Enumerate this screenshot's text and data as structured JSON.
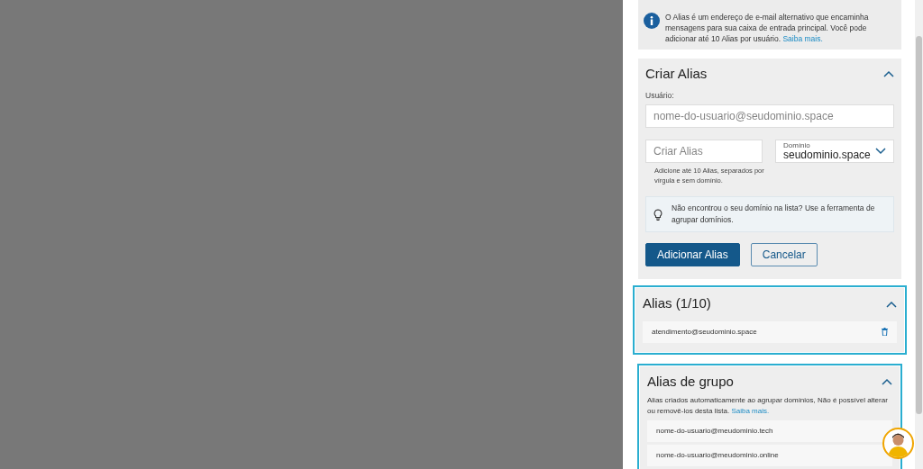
{
  "info": {
    "text": "O Alias é um endereço de e-mail alternativo que encaminha mensagens para sua caixa de entrada principal. Você pode adicionar até 10 Alias por usuário.",
    "link": "Saiba mais."
  },
  "create": {
    "title": "Criar Alias",
    "expanded": true,
    "user_label": "Usuário:",
    "user_placeholder": "nome-do-usuario@seudominio.space",
    "alias_placeholder": "Criar Alias",
    "hint": "Adicione até 10 Alias, separados por vírgula e sem domínio.",
    "domain_label": "Domínio",
    "domain_value": "seudominio.space",
    "tip": "Não encontrou o seu domínio na lista? Use a ferramenta de agrupar domínios.",
    "buttons": [
      {
        "label": "Adicionar Alias",
        "kind": "primary"
      },
      {
        "label": "Cancelar",
        "kind": "secondary"
      }
    ]
  },
  "aliases": {
    "title": "Alias (1/10)",
    "expanded": true,
    "highlighted": true,
    "items": [
      {
        "address": "atendimento@seudominio.space",
        "deletable": true
      }
    ]
  },
  "group_aliases": {
    "title": "Alias de grupo",
    "expanded": true,
    "highlighted": true,
    "text": "Alias criados automaticamente ao agrupar domínios, Não é possível alterar ou removê-los desta lista.",
    "link": "Saiba mais.",
    "items": [
      {
        "address": "nome-do-usuario@meudominio.tech",
        "deletable": false
      },
      {
        "address": "nome-do-usuario@meudominio.online",
        "deletable": false
      }
    ]
  }
}
